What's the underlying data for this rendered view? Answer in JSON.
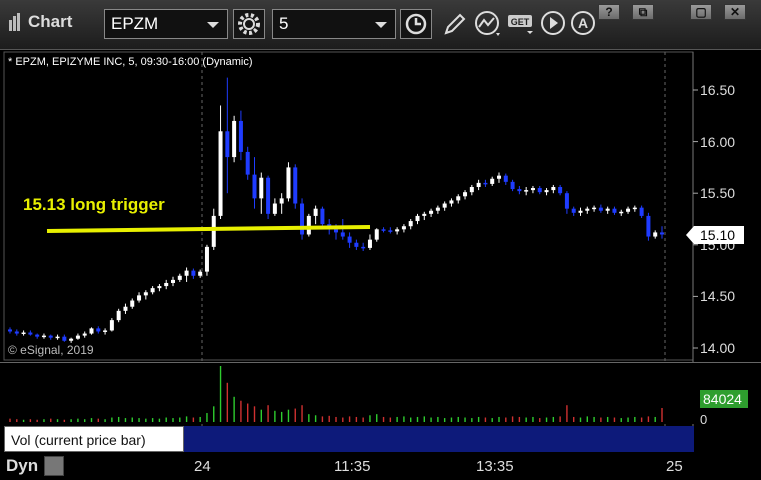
{
  "window": {
    "title": "Chart",
    "symbol_field": "EPZM",
    "interval_field": "5",
    "buttons": [
      "?",
      "⧉",
      "▢",
      "✕"
    ]
  },
  "chart": {
    "description": "* EPZM, EPIZYME INC, 5, 09:30-16:00 (Dynamic)",
    "copyright": "© eSignal, 2019",
    "annotation": "15.13 long trigger",
    "trigger_price": 15.13,
    "last_price": "15.10",
    "y_axis_labels": [
      "16.50",
      "16.00",
      "15.50",
      "15.00",
      "14.50",
      "14.00"
    ],
    "x_axis_labels": [
      "24",
      "11:35",
      "13:35",
      "25"
    ],
    "colors": {
      "up": "#ffffff",
      "down": "#1f3cff",
      "trigger_line": "#e8f000"
    }
  },
  "volume": {
    "label": "Vol (current price bar)",
    "close": "x",
    "last_value": "84024",
    "zero_label": "0"
  },
  "footer": {
    "mode": "Dyn"
  },
  "chart_data": {
    "type": "candlestick",
    "ylim": [
      13.92,
      16.72
    ],
    "candles": [
      [
        14.18,
        14.2,
        14.14,
        14.16
      ],
      [
        14.16,
        14.18,
        14.12,
        14.14
      ],
      [
        14.14,
        14.17,
        14.12,
        14.15
      ],
      [
        14.15,
        14.17,
        14.12,
        14.13
      ],
      [
        14.13,
        14.14,
        14.09,
        14.11
      ],
      [
        14.11,
        14.14,
        14.09,
        14.12
      ],
      [
        14.12,
        14.13,
        14.08,
        14.1
      ],
      [
        14.1,
        14.13,
        14.08,
        14.11
      ],
      [
        14.11,
        14.13,
        14.06,
        14.07
      ],
      [
        14.07,
        14.1,
        14.05,
        14.09
      ],
      [
        14.09,
        14.14,
        14.08,
        14.12
      ],
      [
        14.12,
        14.16,
        14.1,
        14.14
      ],
      [
        14.14,
        14.2,
        14.13,
        14.19
      ],
      [
        14.19,
        14.21,
        14.14,
        14.16
      ],
      [
        14.16,
        14.19,
        14.13,
        14.17
      ],
      [
        14.17,
        14.29,
        14.16,
        14.27
      ],
      [
        14.27,
        14.38,
        14.25,
        14.36
      ],
      [
        14.36,
        14.43,
        14.33,
        14.4
      ],
      [
        14.4,
        14.48,
        14.38,
        14.46
      ],
      [
        14.46,
        14.54,
        14.44,
        14.51
      ],
      [
        14.51,
        14.56,
        14.47,
        14.54
      ],
      [
        14.54,
        14.6,
        14.52,
        14.58
      ],
      [
        14.58,
        14.62,
        14.55,
        14.6
      ],
      [
        14.6,
        14.66,
        14.57,
        14.63
      ],
      [
        14.63,
        14.69,
        14.6,
        14.66
      ],
      [
        14.66,
        14.72,
        14.64,
        14.7
      ],
      [
        14.7,
        14.78,
        14.64,
        14.75
      ],
      [
        14.75,
        14.77,
        14.67,
        14.7
      ],
      [
        14.7,
        14.76,
        14.68,
        14.74
      ],
      [
        14.74,
        15.0,
        14.7,
        14.98
      ],
      [
        14.98,
        15.35,
        14.95,
        15.28
      ],
      [
        15.28,
        16.35,
        15.25,
        16.1
      ],
      [
        16.1,
        16.62,
        15.5,
        15.85
      ],
      [
        15.85,
        16.25,
        15.8,
        16.2
      ],
      [
        16.2,
        16.3,
        15.82,
        15.9
      ],
      [
        15.9,
        15.95,
        15.63,
        15.68
      ],
      [
        15.68,
        15.85,
        15.35,
        15.45
      ],
      [
        15.45,
        15.7,
        15.3,
        15.65
      ],
      [
        15.65,
        15.67,
        15.25,
        15.3
      ],
      [
        15.3,
        15.45,
        15.28,
        15.4
      ],
      [
        15.4,
        15.5,
        15.3,
        15.45
      ],
      [
        15.45,
        15.8,
        15.42,
        15.75
      ],
      [
        15.75,
        15.78,
        15.35,
        15.4
      ],
      [
        15.4,
        15.45,
        15.05,
        15.1
      ],
      [
        15.1,
        15.3,
        15.08,
        15.28
      ],
      [
        15.28,
        15.38,
        15.2,
        15.35
      ],
      [
        15.35,
        15.37,
        15.15,
        15.2
      ],
      [
        15.2,
        15.25,
        15.1,
        15.15
      ],
      [
        15.15,
        15.2,
        15.05,
        15.12
      ],
      [
        15.12,
        15.25,
        15.05,
        15.08
      ],
      [
        15.08,
        15.12,
        14.97,
        15.02
      ],
      [
        15.02,
        15.05,
        14.95,
        14.98
      ],
      [
        14.98,
        15.02,
        14.94,
        14.97
      ],
      [
        14.97,
        15.1,
        14.95,
        15.05
      ],
      [
        15.05,
        15.16,
        15.03,
        15.15
      ],
      [
        15.15,
        15.17,
        15.12,
        15.14
      ],
      [
        15.14,
        15.17,
        15.11,
        15.13
      ],
      [
        15.13,
        15.17,
        15.1,
        15.15
      ],
      [
        15.15,
        15.2,
        15.12,
        15.18
      ],
      [
        15.18,
        15.25,
        15.15,
        15.23
      ],
      [
        15.23,
        15.3,
        15.2,
        15.28
      ],
      [
        15.28,
        15.32,
        15.24,
        15.3
      ],
      [
        15.3,
        15.35,
        15.27,
        15.33
      ],
      [
        15.33,
        15.38,
        15.3,
        15.36
      ],
      [
        15.36,
        15.42,
        15.33,
        15.4
      ],
      [
        15.4,
        15.45,
        15.37,
        15.43
      ],
      [
        15.43,
        15.49,
        15.4,
        15.47
      ],
      [
        15.47,
        15.53,
        15.44,
        15.51
      ],
      [
        15.51,
        15.58,
        15.48,
        15.56
      ],
      [
        15.56,
        15.63,
        15.53,
        15.6
      ],
      [
        15.6,
        15.63,
        15.56,
        15.59
      ],
      [
        15.59,
        15.66,
        15.57,
        15.64
      ],
      [
        15.64,
        15.7,
        15.6,
        15.67
      ],
      [
        15.67,
        15.69,
        15.58,
        15.61
      ],
      [
        15.61,
        15.63,
        15.52,
        15.54
      ],
      [
        15.54,
        15.57,
        15.49,
        15.52
      ],
      [
        15.52,
        15.56,
        15.48,
        15.53
      ],
      [
        15.53,
        15.57,
        15.5,
        15.55
      ],
      [
        15.55,
        15.57,
        15.49,
        15.51
      ],
      [
        15.51,
        15.55,
        15.48,
        15.53
      ],
      [
        15.53,
        15.58,
        15.5,
        15.56
      ],
      [
        15.56,
        15.58,
        15.48,
        15.5
      ],
      [
        15.5,
        15.52,
        15.3,
        15.35
      ],
      [
        15.35,
        15.37,
        15.28,
        15.31
      ],
      [
        15.31,
        15.36,
        15.28,
        15.33
      ],
      [
        15.33,
        15.37,
        15.3,
        15.35
      ],
      [
        15.35,
        15.38,
        15.32,
        15.36
      ],
      [
        15.36,
        15.39,
        15.31,
        15.33
      ],
      [
        15.33,
        15.37,
        15.3,
        15.35
      ],
      [
        15.35,
        15.37,
        15.29,
        15.31
      ],
      [
        15.31,
        15.34,
        15.28,
        15.32
      ],
      [
        15.32,
        15.37,
        15.3,
        15.35
      ],
      [
        15.35,
        15.38,
        15.32,
        15.36
      ],
      [
        15.36,
        15.38,
        15.26,
        15.28
      ],
      [
        15.28,
        15.31,
        15.04,
        15.08
      ],
      [
        15.08,
        15.14,
        15.06,
        15.12
      ],
      [
        15.12,
        15.18,
        15.06,
        15.1
      ]
    ],
    "volume": [
      6,
      5,
      4,
      5,
      4,
      5,
      6,
      5,
      4,
      5,
      6,
      5,
      7,
      6,
      5,
      8,
      9,
      7,
      8,
      7,
      6,
      7,
      6,
      8,
      7,
      8,
      10,
      8,
      9,
      16,
      28,
      100,
      70,
      45,
      38,
      33,
      28,
      22,
      30,
      20,
      18,
      22,
      24,
      30,
      14,
      12,
      10,
      11,
      9,
      8,
      10,
      9,
      8,
      12,
      14,
      9,
      8,
      9,
      10,
      8,
      9,
      10,
      8,
      9,
      7,
      8,
      9,
      8,
      7,
      9,
      8,
      7,
      9,
      8,
      10,
      9,
      8,
      9,
      7,
      8,
      9,
      10,
      30,
      9,
      8,
      10,
      9,
      8,
      9,
      8,
      7,
      8,
      9,
      8,
      10,
      9,
      25
    ]
  }
}
